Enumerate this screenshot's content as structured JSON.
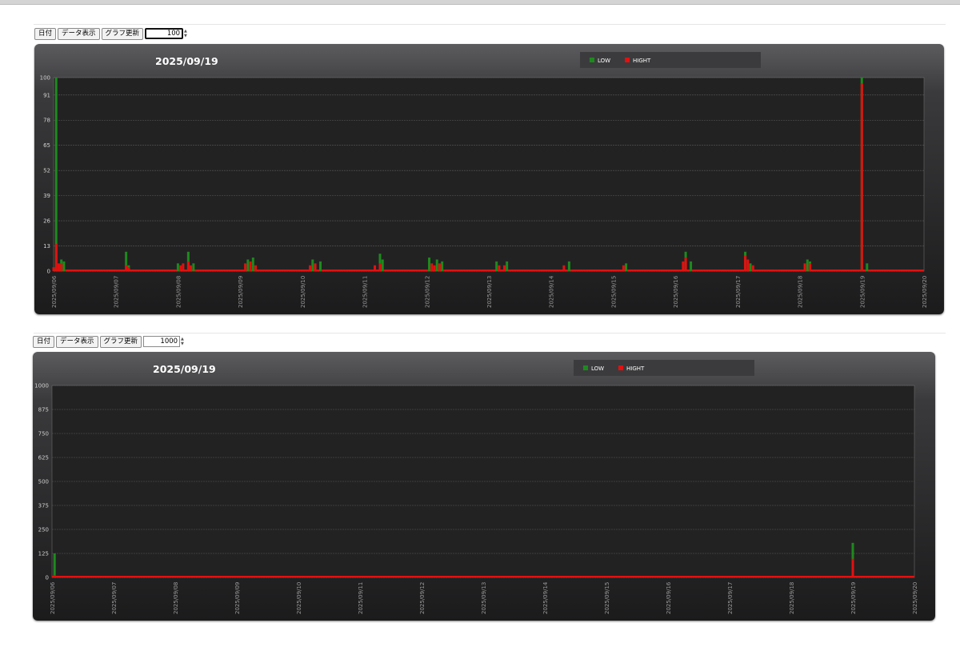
{
  "toolbars": [
    {
      "date_button": "日付",
      "data_button": "データ表示",
      "update_button": "グラフ更新",
      "number_value": "100"
    },
    {
      "date_button": "日付",
      "data_button": "データ表示",
      "update_button": "グラフ更新",
      "number_value": "1000"
    }
  ],
  "colors": {
    "low": "#1d8a1d",
    "high": "#e31010",
    "plot_bg": "#232223",
    "grid": "#5a5a5a"
  },
  "chart_data": [
    {
      "type": "bar",
      "title": "2025/09/19",
      "legend": [
        {
          "name": "LOW",
          "color": "#1d8a1d"
        },
        {
          "name": "HIGHT",
          "color": "#e31010"
        }
      ],
      "legend_position": "top-right",
      "x_labels": [
        "2025/09/06",
        "2025/09/07",
        "2025/09/08",
        "2025/09/09",
        "2025/09/10",
        "2025/09/11",
        "2025/09/12",
        "2025/09/13",
        "2025/09/14",
        "2025/09/15",
        "2025/09/16",
        "2025/09/17",
        "2025/09/18",
        "2025/09/19",
        "2025/09/20"
      ],
      "y_ticks": [
        0,
        13,
        26,
        39,
        52,
        65,
        78,
        91,
        100
      ],
      "ylim": [
        0,
        100
      ],
      "xlim": [
        "2025/09/06",
        "2025/09/20"
      ],
      "grid": true,
      "series": [
        {
          "name": "LOW",
          "points": [
            {
              "x": "2025/09/06 01:00",
              "y": 100
            },
            {
              "x": "2025/09/06 03:00",
              "y": 6
            },
            {
              "x": "2025/09/06 04:00",
              "y": 5
            },
            {
              "x": "2025/09/07 04:00",
              "y": 10
            },
            {
              "x": "2025/09/07 05:00",
              "y": 3
            },
            {
              "x": "2025/09/08 00:00",
              "y": 4
            },
            {
              "x": "2025/09/08 04:00",
              "y": 10
            },
            {
              "x": "2025/09/08 06:00",
              "y": 4
            },
            {
              "x": "2025/09/09 03:00",
              "y": 6
            },
            {
              "x": "2025/09/09 05:00",
              "y": 7
            },
            {
              "x": "2025/09/10 04:00",
              "y": 6
            },
            {
              "x": "2025/09/10 07:00",
              "y": 5
            },
            {
              "x": "2025/09/11 06:00",
              "y": 9
            },
            {
              "x": "2025/09/11 07:00",
              "y": 6
            },
            {
              "x": "2025/09/12 01:00",
              "y": 7
            },
            {
              "x": "2025/09/12 04:00",
              "y": 6
            },
            {
              "x": "2025/09/12 06:00",
              "y": 5
            },
            {
              "x": "2025/09/13 03:00",
              "y": 5
            },
            {
              "x": "2025/09/13 07:00",
              "y": 5
            },
            {
              "x": "2025/09/14 07:00",
              "y": 5
            },
            {
              "x": "2025/09/15 05:00",
              "y": 4
            },
            {
              "x": "2025/09/16 04:00",
              "y": 10
            },
            {
              "x": "2025/09/16 06:00",
              "y": 5
            },
            {
              "x": "2025/09/17 03:00",
              "y": 10
            },
            {
              "x": "2025/09/17 05:00",
              "y": 4
            },
            {
              "x": "2025/09/18 03:00",
              "y": 6
            },
            {
              "x": "2025/09/18 04:00",
              "y": 5
            },
            {
              "x": "2025/09/19 00:00",
              "y": 100
            },
            {
              "x": "2025/09/19 02:00",
              "y": 4
            }
          ]
        },
        {
          "name": "HIGHT",
          "points": [
            {
              "x": "2025/09/06 00:00",
              "y": 2
            },
            {
              "x": "2025/09/06 01:00",
              "y": 14
            },
            {
              "x": "2025/09/06 02:00",
              "y": 4
            },
            {
              "x": "2025/09/06 03:00",
              "y": 4
            },
            {
              "x": "2025/09/07 04:00",
              "y": 3
            },
            {
              "x": "2025/09/07 05:00",
              "y": 2
            },
            {
              "x": "2025/09/08 01:00",
              "y": 3
            },
            {
              "x": "2025/09/08 02:00",
              "y": 4
            },
            {
              "x": "2025/09/08 04:00",
              "y": 5
            },
            {
              "x": "2025/09/08 05:00",
              "y": 3
            },
            {
              "x": "2025/09/09 02:00",
              "y": 4
            },
            {
              "x": "2025/09/09 04:00",
              "y": 5
            },
            {
              "x": "2025/09/09 06:00",
              "y": 3
            },
            {
              "x": "2025/09/10 03:00",
              "y": 3
            },
            {
              "x": "2025/09/10 05:00",
              "y": 4
            },
            {
              "x": "2025/09/11 04:00",
              "y": 3
            },
            {
              "x": "2025/09/11 06:00",
              "y": 4
            },
            {
              "x": "2025/09/12 02:00",
              "y": 4
            },
            {
              "x": "2025/09/12 03:00",
              "y": 3
            },
            {
              "x": "2025/09/12 05:00",
              "y": 4
            },
            {
              "x": "2025/09/13 04:00",
              "y": 3
            },
            {
              "x": "2025/09/13 06:00",
              "y": 3
            },
            {
              "x": "2025/09/14 05:00",
              "y": 3
            },
            {
              "x": "2025/09/15 04:00",
              "y": 3
            },
            {
              "x": "2025/09/16 03:00",
              "y": 5
            },
            {
              "x": "2025/09/16 04:00",
              "y": 7
            },
            {
              "x": "2025/09/17 03:00",
              "y": 8
            },
            {
              "x": "2025/09/17 04:00",
              "y": 6
            },
            {
              "x": "2025/09/17 06:00",
              "y": 3
            },
            {
              "x": "2025/09/18 02:00",
              "y": 4
            },
            {
              "x": "2025/09/18 04:00",
              "y": 4
            },
            {
              "x": "2025/09/19 00:00",
              "y": 97
            }
          ]
        }
      ]
    },
    {
      "type": "bar",
      "title": "2025/09/19",
      "legend": [
        {
          "name": "LOW",
          "color": "#1d8a1d"
        },
        {
          "name": "HIGHT",
          "color": "#e31010"
        }
      ],
      "legend_position": "top-right",
      "x_labels": [
        "2025/09/06",
        "2025/09/07",
        "2025/09/08",
        "2025/09/09",
        "2025/09/10",
        "2025/09/11",
        "2025/09/12",
        "2025/09/13",
        "2025/09/14",
        "2025/09/15",
        "2025/09/16",
        "2025/09/17",
        "2025/09/18",
        "2025/09/19",
        "2025/09/20"
      ],
      "y_ticks": [
        0,
        125,
        250,
        375,
        500,
        625,
        750,
        875,
        1000
      ],
      "ylim": [
        0,
        1000
      ],
      "xlim": [
        "2025/09/06",
        "2025/09/20"
      ],
      "grid": true,
      "series": [
        {
          "name": "LOW",
          "points": [
            {
              "x": "2025/09/06 01:00",
              "y": 125
            },
            {
              "x": "2025/09/19 00:00",
              "y": 180
            }
          ]
        },
        {
          "name": "HIGHT",
          "points": [
            {
              "x": "2025/09/06 01:00",
              "y": 12
            },
            {
              "x": "2025/09/19 00:00",
              "y": 97
            }
          ]
        }
      ]
    }
  ]
}
